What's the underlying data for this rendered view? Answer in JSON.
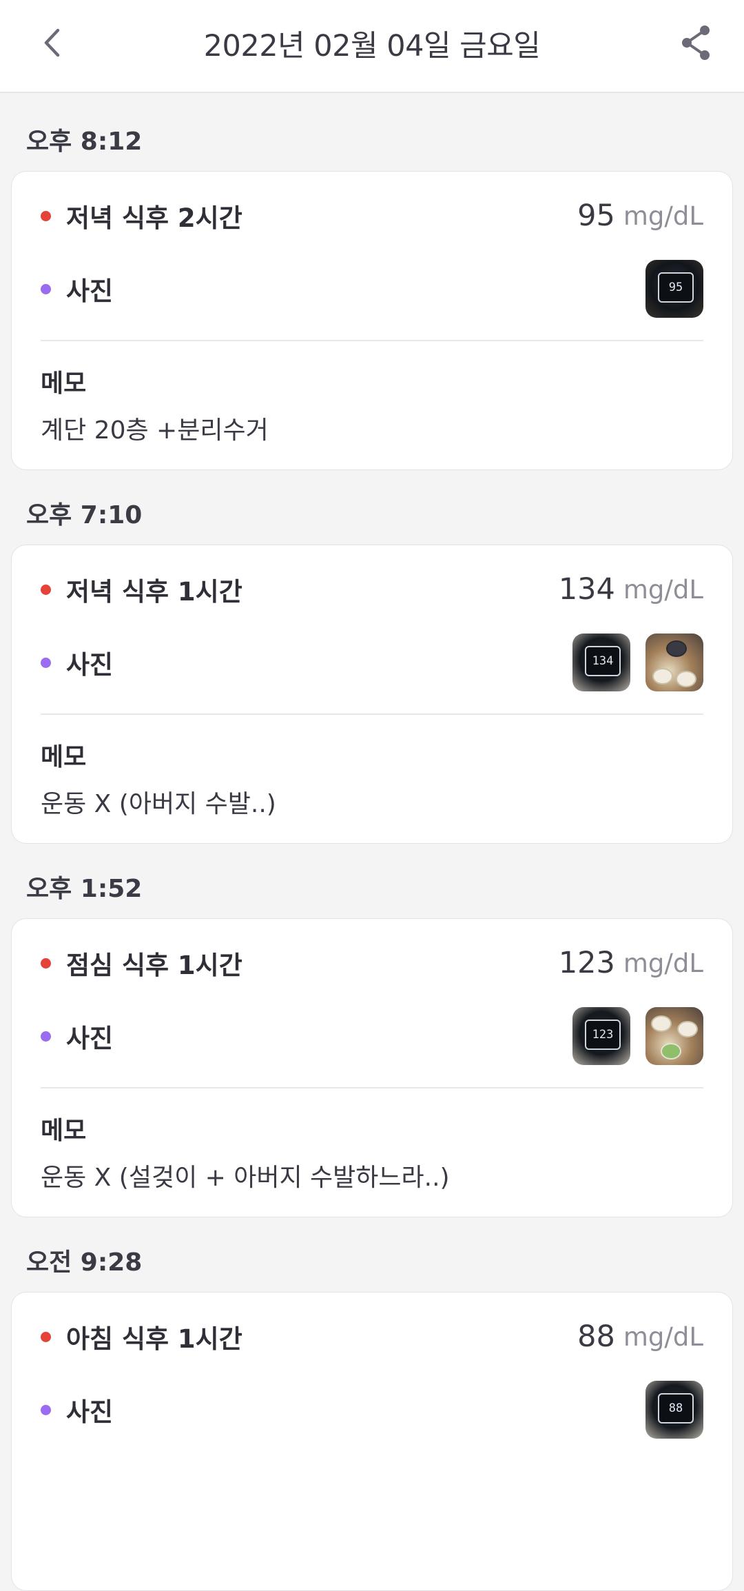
{
  "header": {
    "title": "2022년 02월 04일 금요일",
    "back_icon": "chevron-left-icon",
    "share_icon": "share-icon"
  },
  "colors": {
    "measure_dot": "#e5423a",
    "photo_dot": "#9a6cf0",
    "background": "#f4f4f5"
  },
  "entries": [
    {
      "time": "오후 8:12",
      "measure_label": "저녁 식후 2시간",
      "value": "95",
      "unit": "mg/dL",
      "photo_label": "사진",
      "photos": [
        "95"
      ],
      "memo_title": "메모",
      "memo": "계단 20층 +분리수거"
    },
    {
      "time": "오후 7:10",
      "measure_label": "저녁 식후 1시간",
      "value": "134",
      "unit": "mg/dL",
      "photo_label": "사진",
      "photos": [
        "134",
        ""
      ],
      "memo_title": "메모",
      "memo": "운동 X (아버지 수발..)"
    },
    {
      "time": "오후 1:52",
      "measure_label": "점심 식후 1시간",
      "value": "123",
      "unit": "mg/dL",
      "photo_label": "사진",
      "photos": [
        "123",
        ""
      ],
      "memo_title": "메모",
      "memo": "운동 X (설겆이 + 아버지 수발하느라..)"
    },
    {
      "time": "오전 9:28",
      "measure_label": "아침 식후 1시간",
      "value": "88",
      "unit": "mg/dL",
      "photo_label": "사진",
      "photos": [
        "88"
      ]
    }
  ]
}
